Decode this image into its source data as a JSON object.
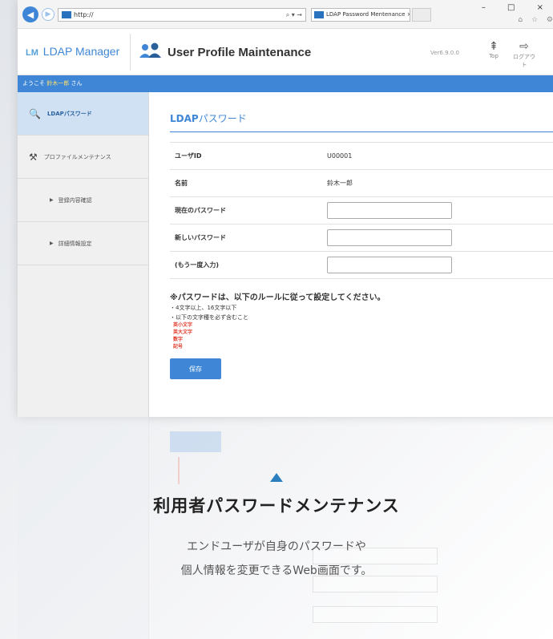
{
  "browser": {
    "address_text": "http://",
    "address_tools": "⌕ ▾ →",
    "tab_title": "LDAP Password Mentenance ×",
    "window_controls": "– □ ×",
    "toolbar_icons": "⌂ ☆ ⚙"
  },
  "header": {
    "logo_mark": "LM",
    "logo_text": "LDAP Manager",
    "title": "User Profile Maintenance",
    "version": "Ver6.9.0.0",
    "top_icon": "⇞",
    "top_label": "Top",
    "logout_icon": "⇨",
    "logout_label": "ログアウト"
  },
  "welcome": {
    "prefix": "ようこそ",
    "user": "鈴木一郎",
    "suffix": "さん"
  },
  "sidebar": {
    "items": [
      {
        "icon": "🔍",
        "label": "LDAPパスワード"
      },
      {
        "icon": "⚒",
        "label": "プロファイルメンテナンス"
      },
      {
        "icon": "▶",
        "label": "登録内容確認"
      },
      {
        "icon": "▶",
        "label": "詳細情報設定"
      }
    ]
  },
  "main": {
    "title_strong": "LDAP",
    "title_rest": "パスワード",
    "rows": [
      {
        "label": "ユーザID",
        "value": "U00001"
      },
      {
        "label": "名前",
        "value": "鈴木一郎"
      },
      {
        "label": "現在のパスワード",
        "value": ""
      },
      {
        "label": "新しいパスワード",
        "value": ""
      },
      {
        "label": "(もう一度入力)",
        "value": ""
      }
    ],
    "notice": "※パスワードは、以下のルールに従って設定してください。",
    "rules": [
      "・4文字以上、16文字以下",
      "・以下の文字種を必ず含むこと"
    ],
    "char_types": [
      "英小文字",
      "英大文字",
      "数字",
      "記号"
    ],
    "save_label": "保存"
  },
  "overlay": {
    "title": "利用者パスワードメンテナンス",
    "desc_line1": "エンドユーザが自身のパスワードや",
    "desc_line2": "個人情報を変更できるWeb画面です。"
  },
  "colors": {
    "accent": "#3f87d6",
    "warning": "#e23b2a",
    "sidebar_active": "#cfe1f2"
  }
}
